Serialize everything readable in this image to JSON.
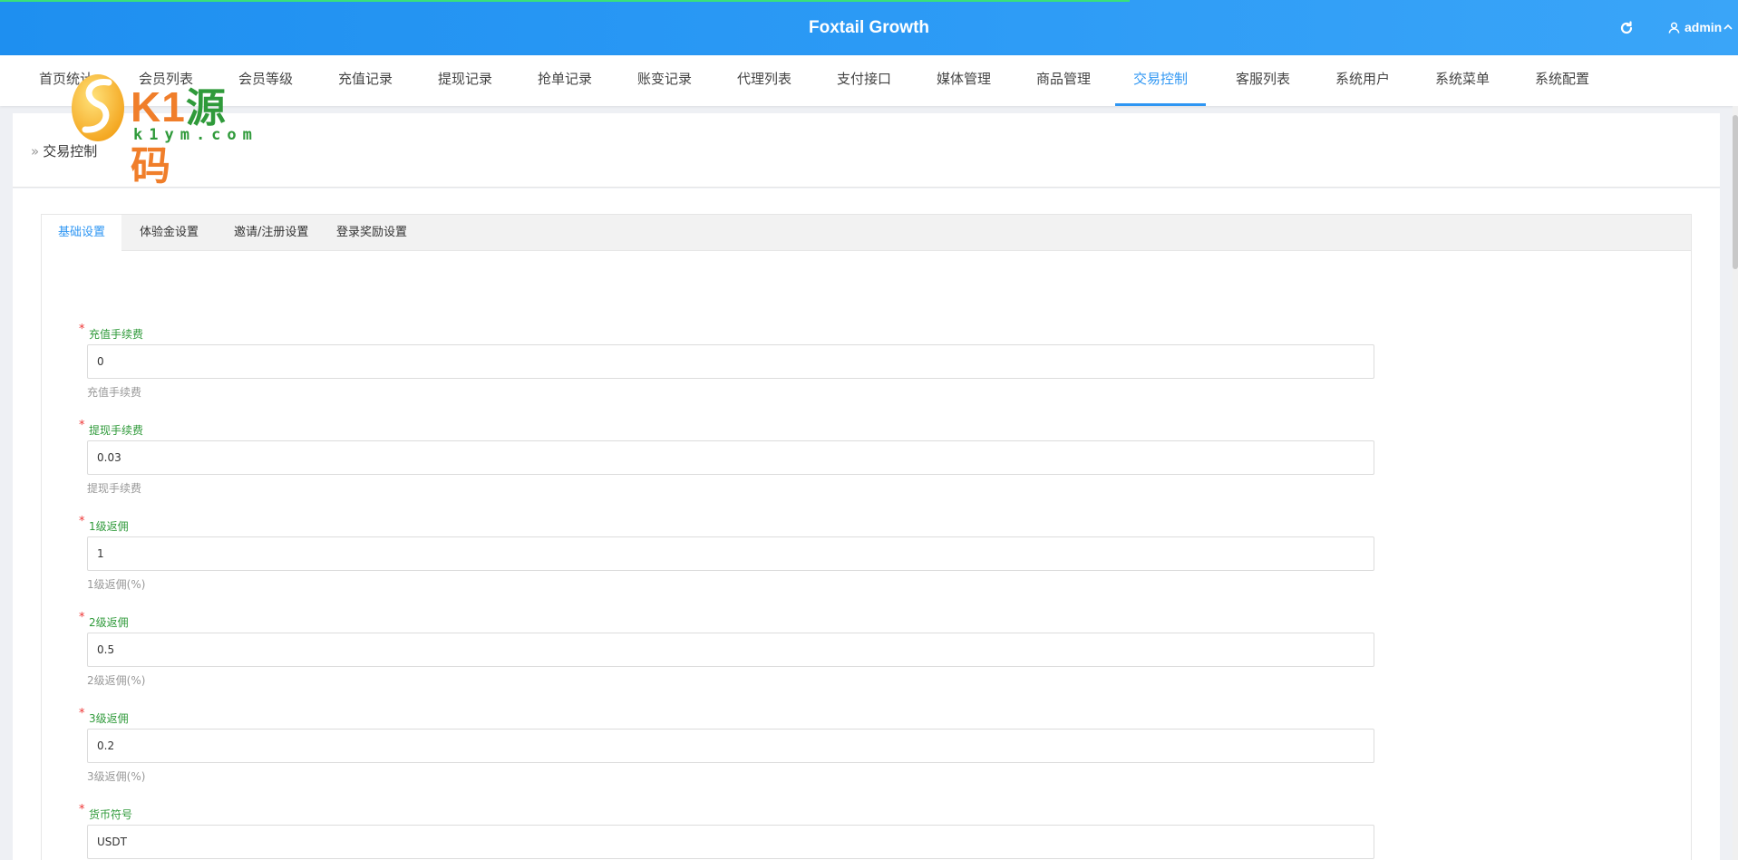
{
  "header": {
    "title": "Foxtail Growth",
    "user_name": "admin"
  },
  "nav": {
    "items": [
      {
        "label": "首页统计"
      },
      {
        "label": "会员列表"
      },
      {
        "label": "会员等级"
      },
      {
        "label": "充值记录"
      },
      {
        "label": "提现记录"
      },
      {
        "label": "抢单记录"
      },
      {
        "label": "账变记录"
      },
      {
        "label": "代理列表"
      },
      {
        "label": "支付接口"
      },
      {
        "label": "媒体管理"
      },
      {
        "label": "商品管理"
      },
      {
        "label": "交易控制"
      },
      {
        "label": "客服列表"
      },
      {
        "label": "系统用户"
      },
      {
        "label": "系统菜单"
      },
      {
        "label": "系统配置"
      }
    ],
    "active_index": 11
  },
  "watermark": {
    "brand_k1": "K1",
    "brand_yuan": "源",
    "brand_ma": "码",
    "domain": "k1ym.com"
  },
  "breadcrumb": {
    "arrows": "»",
    "label": "交易控制"
  },
  "tabs": [
    {
      "label": "基础设置"
    },
    {
      "label": "体验金设置"
    },
    {
      "label": "邀请/注册设置"
    },
    {
      "label": "登录奖励设置"
    }
  ],
  "form": {
    "required_mark": "*",
    "fields": [
      {
        "label": "充值手续费",
        "value": "0",
        "help": "充值手续费"
      },
      {
        "label": "提现手续费",
        "value": "0.03",
        "help": "提现手续费"
      },
      {
        "label": "1级返佣",
        "value": "1",
        "help": "1级返佣(%)"
      },
      {
        "label": "2级返佣",
        "value": "0.5",
        "help": "2级返佣(%)"
      },
      {
        "label": "3级返佣",
        "value": "0.2",
        "help": "3级返佣(%)"
      },
      {
        "label": "货币符号",
        "value": "USDT",
        "help": ""
      }
    ]
  },
  "colors": {
    "header_blue": "#2e96f3",
    "active_tab": "#2e96f3",
    "label_green": "#2f9a3a",
    "required_red": "#e33333",
    "logo_orange": "#f07e2a"
  },
  "icons": {
    "refresh": "refresh-icon",
    "user": "user-icon",
    "chevron": "chevron-up-icon",
    "breadcrumb": "double-chevron-right-icon"
  }
}
